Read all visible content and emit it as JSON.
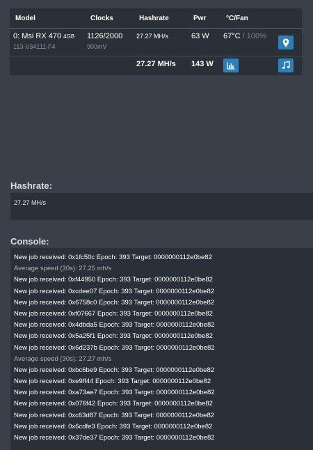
{
  "gpu_table": {
    "headers": {
      "model": "Model",
      "clocks": "Clocks",
      "hashrate": "Hashrate",
      "power": "Pwr",
      "temp_fan": "°C/Fan"
    },
    "row": {
      "model_name": "0: Msi RX 470",
      "model_mem": "4GB",
      "model_sub": "113-V34111-F4",
      "clocks": "1126/2000",
      "voltage": "900mV",
      "hashrate": "27.27 MH/s",
      "power": "63 W",
      "temp": "67°C",
      "fan_sep": " / ",
      "fan": "100%",
      "location_icon": "map-pin-icon"
    },
    "total": {
      "hashrate": "27.27 MH/s",
      "power": "143 W",
      "chart_icon": "bar-chart-icon",
      "music_icon": "music-note-icon"
    }
  },
  "hashrate_section": {
    "title": "Hashrate:",
    "value": "27.27 MH/s"
  },
  "console_section": {
    "title": "Console:",
    "lines": [
      "New job received: 0x1fc50c Epoch: 393 Target: 0000000112e0be82",
      "Average speed (30s): 27.25 mh/s",
      "New job received: 0xf44950 Epoch: 393 Target: 0000000112e0be82",
      "New job received: 0xcdee07 Epoch: 393 Target: 0000000112e0be82",
      "New job received: 0x6758c0 Epoch: 393 Target: 0000000112e0be82",
      "New job received: 0xf07667 Epoch: 393 Target: 0000000112e0be82",
      "New job received: 0x4dbda5 Epoch: 393 Target: 0000000112e0be82",
      "New job received: 0x5a25f1 Epoch: 393 Target: 0000000112e0be82",
      "New job received: 0x6d237b Epoch: 393 Target: 0000000112e0be82",
      "Average speed (30s): 27.27 mh/s",
      "New job received: 0xbc6be9 Epoch: 393 Target: 0000000112e0be82",
      "New job received: 0xe9ff44 Epoch: 393 Target: 0000000112e0be82",
      "New job received: 0xa73ae7 Epoch: 393 Target: 0000000112e0be82",
      "New job received: 0x076f42 Epoch: 393 Target: 0000000112e0be82",
      "New job received: 0xc63d87 Epoch: 393 Target: 0000000112e0be82",
      "New job received: 0x6cdfe3 Epoch: 393 Target: 0000000112e0be82",
      "New job received: 0x37de37 Epoch: 393 Target: 0000000112e0be82"
    ]
  },
  "colors": {
    "background": "#394049",
    "panel": "#2a3037",
    "accent": "#2f7fb7"
  }
}
